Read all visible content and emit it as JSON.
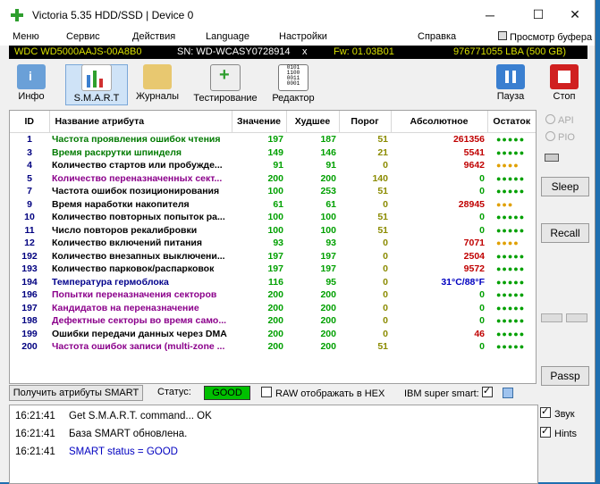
{
  "window": {
    "title": "Victoria 5.35 HDD/SSD | Device 0",
    "minimize": "─",
    "maximize": "☐",
    "close": "✕"
  },
  "menu": [
    "Меню",
    "Сервис",
    "Действия",
    "Language",
    "Настройки",
    "Справка",
    "Просмотр буфера"
  ],
  "device": {
    "model": "WDC WD5000AAJS-00A8B0",
    "serial": "SN: WD-WCASY0728914",
    "sep": "x",
    "fw": "Fw: 01.03B01",
    "capacity": "976771055 LBA (500 GB)"
  },
  "toolbar": [
    "Инфо",
    "S.M.A.R.T",
    "Журналы",
    "Тестирование",
    "Редактор",
    "Пауза",
    "Стоп"
  ],
  "columns": [
    "ID",
    "Название атрибута",
    "Значение",
    "Худшее",
    "Порог",
    "Абсолютное",
    "Остаток"
  ],
  "rows": [
    {
      "id": "1",
      "name": "Частота проявления ошибок чтения",
      "v": "197",
      "w": "187",
      "t": "51",
      "a": "261356",
      "r": "●●●●●",
      "nc": "#007a00",
      "ac": "#c00000",
      "rc": "#00a000"
    },
    {
      "id": "3",
      "name": "Время раскрутки шпинделя",
      "v": "149",
      "w": "146",
      "t": "21",
      "a": "5541",
      "r": "●●●●●",
      "nc": "#007a00",
      "ac": "#c00000",
      "rc": "#00a000"
    },
    {
      "id": "4",
      "name": "Количество стартов или пробужде...",
      "v": "91",
      "w": "91",
      "t": "0",
      "a": "9642",
      "r": "●●●●",
      "nc": "#000000",
      "ac": "#c00000",
      "rc": "#e0a000"
    },
    {
      "id": "5",
      "name": "Количество переназначенных сект...",
      "v": "200",
      "w": "200",
      "t": "140",
      "a": "0",
      "r": "●●●●●",
      "nc": "#8b008b",
      "ac": "#00a000",
      "rc": "#00a000"
    },
    {
      "id": "7",
      "name": "Частота ошибок позиционирования",
      "v": "100",
      "w": "253",
      "t": "51",
      "a": "0",
      "r": "●●●●●",
      "nc": "#000000",
      "ac": "#00a000",
      "rc": "#00a000"
    },
    {
      "id": "9",
      "name": "Время наработки накопителя",
      "v": "61",
      "w": "61",
      "t": "0",
      "a": "28945",
      "r": "●●●",
      "nc": "#000000",
      "ac": "#c00000",
      "rc": "#e0a000"
    },
    {
      "id": "10",
      "name": "Количество повторных попыток ра...",
      "v": "100",
      "w": "100",
      "t": "51",
      "a": "0",
      "r": "●●●●●",
      "nc": "#000000",
      "ac": "#00a000",
      "rc": "#00a000"
    },
    {
      "id": "11",
      "name": "Число повторов рекалибровки",
      "v": "100",
      "w": "100",
      "t": "51",
      "a": "0",
      "r": "●●●●●",
      "nc": "#000000",
      "ac": "#00a000",
      "rc": "#00a000"
    },
    {
      "id": "12",
      "name": "Количество включений питания",
      "v": "93",
      "w": "93",
      "t": "0",
      "a": "7071",
      "r": "●●●●",
      "nc": "#000000",
      "ac": "#c00000",
      "rc": "#e0a000"
    },
    {
      "id": "192",
      "name": "Количество внезапных выключени...",
      "v": "197",
      "w": "197",
      "t": "0",
      "a": "2504",
      "r": "●●●●●",
      "nc": "#000000",
      "ac": "#c00000",
      "rc": "#00a000"
    },
    {
      "id": "193",
      "name": "Количество парковок/распарковок",
      "v": "197",
      "w": "197",
      "t": "0",
      "a": "9572",
      "r": "●●●●●",
      "nc": "#000000",
      "ac": "#c00000",
      "rc": "#00a000"
    },
    {
      "id": "194",
      "name": "Температура гермоблока",
      "v": "116",
      "w": "95",
      "t": "0",
      "a": "31°C/88°F",
      "r": "●●●●●",
      "nc": "#00008b",
      "ac": "#0000c0",
      "rc": "#00a000"
    },
    {
      "id": "196",
      "name": "Попытки переназначения секторов",
      "v": "200",
      "w": "200",
      "t": "0",
      "a": "0",
      "r": "●●●●●",
      "nc": "#8b008b",
      "ac": "#00a000",
      "rc": "#00a000"
    },
    {
      "id": "197",
      "name": "Кандидатов на переназначение",
      "v": "200",
      "w": "200",
      "t": "0",
      "a": "0",
      "r": "●●●●●",
      "nc": "#8b008b",
      "ac": "#00a000",
      "rc": "#00a000"
    },
    {
      "id": "198",
      "name": "Дефектные секторы во время само...",
      "v": "200",
      "w": "200",
      "t": "0",
      "a": "0",
      "r": "●●●●●",
      "nc": "#8b008b",
      "ac": "#00a000",
      "rc": "#00a000"
    },
    {
      "id": "199",
      "name": "Ошибки передачи данных через DMA",
      "v": "200",
      "w": "200",
      "t": "0",
      "a": "46",
      "r": "●●●●●",
      "nc": "#000000",
      "ac": "#c00000",
      "rc": "#00a000"
    },
    {
      "id": "200",
      "name": "Частота ошибок записи (multi-zone ...",
      "v": "200",
      "w": "200",
      "t": "51",
      "a": "0",
      "r": "●●●●●",
      "nc": "#8b008b",
      "ac": "#00a000",
      "rc": "#00a000"
    }
  ],
  "right": {
    "api": "API",
    "pio": "PIO",
    "sleep": "Sleep",
    "recall": "Recall",
    "passp": "Passp"
  },
  "bottom": {
    "get": "Получить атрибуты SMART",
    "status_label": "Статус:",
    "status": "GOOD",
    "raw": "RAW отображать в HEX",
    "ibm": "IBM super smart:"
  },
  "log": [
    {
      "time": "16:21:41",
      "text": "Get S.M.A.R.T. command... OK",
      "color": "#000000"
    },
    {
      "time": "16:21:41",
      "text": "База SMART обновлена.",
      "color": "#000000"
    },
    {
      "time": "16:21:41",
      "text": "SMART status = GOOD",
      "color": "#0000c0"
    }
  ],
  "checks": {
    "sound": "Звук",
    "hints": "Hints"
  },
  "colors": {
    "id": "#000080",
    "value": "#00a000",
    "threshold": "#8b8b00"
  }
}
